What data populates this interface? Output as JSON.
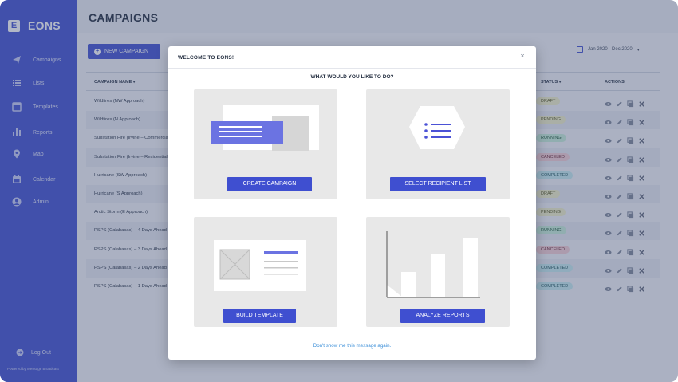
{
  "app": {
    "brand_letter": "E",
    "brand_name": "EONS",
    "page_title": "CAMPAIGNS",
    "powered_by": "Powered by Message Broadcast"
  },
  "sidebar": {
    "items": [
      {
        "label": "Campaigns",
        "icon": "send-icon"
      },
      {
        "label": "Lists",
        "icon": "list-icon"
      },
      {
        "label": "Templates",
        "icon": "template-icon"
      },
      {
        "label": "Reports",
        "icon": "bar-chart-icon"
      },
      {
        "label": "Map",
        "icon": "map-pin-icon"
      },
      {
        "label": "Calendar",
        "icon": "calendar-icon"
      },
      {
        "label": "Admin",
        "icon": "user-icon"
      }
    ],
    "logout_label": "Log Out"
  },
  "toolbar": {
    "new_campaign_label": "NEW CAMPAIGN",
    "date_range": "Jan 2020 - Dec 2020"
  },
  "table": {
    "headers": {
      "name": "CAMPAIGN NAME",
      "status": "STATUS",
      "actions": "ACTIONS"
    },
    "rows": [
      {
        "name": "Wildfires (NW Approach)",
        "status": "DRAFT"
      },
      {
        "name": "Wildfires (N Approach)",
        "status": "PENDING"
      },
      {
        "name": "Substation Fire (Irvine – Commercial)",
        "status": "RUNNING"
      },
      {
        "name": "Substation Fire (Irvine – Residential)",
        "status": "CANCELED"
      },
      {
        "name": "Hurricane (SW Approach)",
        "status": "COMPLETED"
      },
      {
        "name": "Hurricane (S Approach)",
        "status": "DRAFT"
      },
      {
        "name": "Arctic Storm (E Approach)",
        "status": "PENDING"
      },
      {
        "name": "PSPS (Calabasas) – 4 Days Ahead",
        "status": "RUNNING"
      },
      {
        "name": "PSPS (Calabasas) – 3 Days Ahead",
        "status": "CANCELED"
      },
      {
        "name": "PSPS (Calabasas) – 2 Days Ahead",
        "status": "COMPLETED"
      },
      {
        "name": "PSPS (Calabasas) – 1 Days Ahead",
        "status": "COMPLETED"
      }
    ]
  },
  "modal": {
    "title": "WELCOME TO EONS!",
    "close_symbol": "×",
    "question": "WHAT WOULD YOU LIKE TO DO?",
    "cards": [
      {
        "button_label": "CREATE CAMPAIGN"
      },
      {
        "button_label": "SELECT RECIPIENT LIST"
      },
      {
        "button_label": "BUILD TEMPLATE"
      },
      {
        "button_label": "ANALYZE REPORTS"
      }
    ],
    "dont_show_label": "Don't show me this message again."
  },
  "colors": {
    "brand": "#3f4fd0",
    "link": "#3a8ed8"
  }
}
